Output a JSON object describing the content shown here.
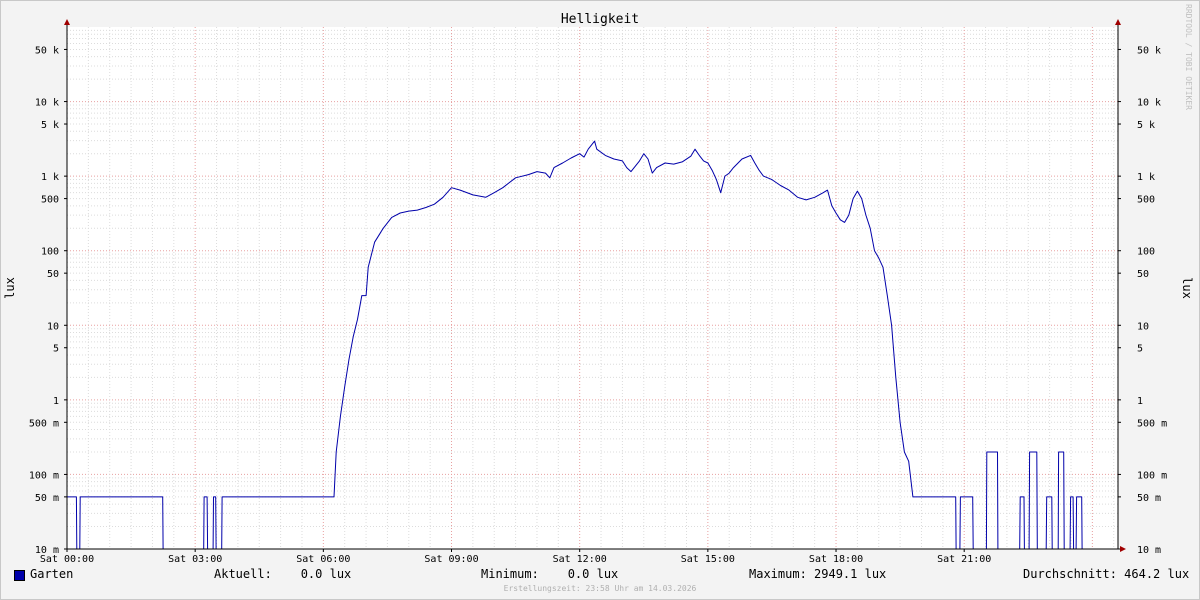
{
  "chart_data": {
    "type": "line",
    "title": "Helligkeit",
    "ylabel": "lux",
    "y_scale": "log",
    "ylim": [
      0.01,
      100000
    ],
    "y_ticks": [
      {
        "value": 50000,
        "label": "50 k"
      },
      {
        "value": 10000,
        "label": "10 k"
      },
      {
        "value": 5000,
        "label": "5 k"
      },
      {
        "value": 1000,
        "label": "1 k"
      },
      {
        "value": 500,
        "label": "500"
      },
      {
        "value": 100,
        "label": "100"
      },
      {
        "value": 50,
        "label": "50"
      },
      {
        "value": 10,
        "label": "10"
      },
      {
        "value": 5,
        "label": "5"
      },
      {
        "value": 1,
        "label": "1"
      },
      {
        "value": 0.5,
        "label": "500 m"
      },
      {
        "value": 0.1,
        "label": "100 m"
      },
      {
        "value": 0.05,
        "label": "50 m"
      },
      {
        "value": 0.01,
        "label": "10 m"
      }
    ],
    "xlim": [
      0,
      24.6
    ],
    "x_ticks": [
      {
        "value": 0,
        "label": "Sat 00:00"
      },
      {
        "value": 3,
        "label": "Sat 03:00"
      },
      {
        "value": 6,
        "label": "Sat 06:00"
      },
      {
        "value": 9,
        "label": "Sat 09:00"
      },
      {
        "value": 12,
        "label": "Sat 12:00"
      },
      {
        "value": 15,
        "label": "Sat 15:00"
      },
      {
        "value": 18,
        "label": "Sat 18:00"
      },
      {
        "value": 21,
        "label": "Sat 21:00"
      }
    ],
    "grid": true,
    "series": [
      {
        "name": "Garten",
        "color": "#0000aa",
        "points": [
          [
            0.0,
            0.05
          ],
          [
            0.22,
            0.05
          ],
          [
            0.23,
            0.01
          ],
          [
            0.3,
            0.01
          ],
          [
            0.31,
            0.05
          ],
          [
            2.24,
            0.05
          ],
          [
            2.25,
            0.01
          ],
          [
            3.2,
            0.01
          ],
          [
            3.21,
            0.05
          ],
          [
            3.28,
            0.05
          ],
          [
            3.29,
            0.01
          ],
          [
            3.42,
            0.01
          ],
          [
            3.43,
            0.05
          ],
          [
            3.48,
            0.05
          ],
          [
            3.49,
            0.01
          ],
          [
            3.62,
            0.01
          ],
          [
            3.63,
            0.05
          ],
          [
            6.25,
            0.05
          ],
          [
            6.3,
            0.2
          ],
          [
            6.4,
            0.6
          ],
          [
            6.5,
            1.5
          ],
          [
            6.6,
            3.5
          ],
          [
            6.7,
            7
          ],
          [
            6.8,
            12
          ],
          [
            6.9,
            25
          ],
          [
            7.0,
            25
          ],
          [
            7.05,
            60
          ],
          [
            7.2,
            130
          ],
          [
            7.4,
            200
          ],
          [
            7.6,
            280
          ],
          [
            7.8,
            320
          ],
          [
            8.0,
            340
          ],
          [
            8.2,
            350
          ],
          [
            8.4,
            380
          ],
          [
            8.6,
            420
          ],
          [
            8.8,
            520
          ],
          [
            9.0,
            700
          ],
          [
            9.2,
            650
          ],
          [
            9.5,
            560
          ],
          [
            9.8,
            520
          ],
          [
            10.0,
            600
          ],
          [
            10.2,
            700
          ],
          [
            10.5,
            950
          ],
          [
            10.8,
            1050
          ],
          [
            11.0,
            1150
          ],
          [
            11.2,
            1100
          ],
          [
            11.3,
            950
          ],
          [
            11.4,
            1300
          ],
          [
            11.6,
            1500
          ],
          [
            11.8,
            1750
          ],
          [
            12.0,
            2000
          ],
          [
            12.1,
            1800
          ],
          [
            12.2,
            2300
          ],
          [
            12.35,
            2950
          ],
          [
            12.4,
            2300
          ],
          [
            12.6,
            1900
          ],
          [
            12.8,
            1700
          ],
          [
            13.0,
            1600
          ],
          [
            13.1,
            1300
          ],
          [
            13.2,
            1150
          ],
          [
            13.4,
            1600
          ],
          [
            13.5,
            2000
          ],
          [
            13.6,
            1700
          ],
          [
            13.7,
            1100
          ],
          [
            13.8,
            1300
          ],
          [
            14.0,
            1500
          ],
          [
            14.2,
            1450
          ],
          [
            14.4,
            1550
          ],
          [
            14.6,
            1850
          ],
          [
            14.7,
            2300
          ],
          [
            14.8,
            1900
          ],
          [
            14.9,
            1600
          ],
          [
            15.0,
            1500
          ],
          [
            15.1,
            1200
          ],
          [
            15.2,
            900
          ],
          [
            15.3,
            600
          ],
          [
            15.4,
            1000
          ],
          [
            15.5,
            1100
          ],
          [
            15.6,
            1300
          ],
          [
            15.8,
            1700
          ],
          [
            16.0,
            1900
          ],
          [
            16.1,
            1500
          ],
          [
            16.2,
            1200
          ],
          [
            16.3,
            1000
          ],
          [
            16.5,
            900
          ],
          [
            16.7,
            750
          ],
          [
            16.9,
            650
          ],
          [
            17.1,
            520
          ],
          [
            17.3,
            480
          ],
          [
            17.5,
            520
          ],
          [
            17.7,
            600
          ],
          [
            17.8,
            650
          ],
          [
            17.9,
            400
          ],
          [
            18.0,
            320
          ],
          [
            18.1,
            260
          ],
          [
            18.2,
            240
          ],
          [
            18.3,
            300
          ],
          [
            18.4,
            500
          ],
          [
            18.5,
            630
          ],
          [
            18.6,
            500
          ],
          [
            18.7,
            300
          ],
          [
            18.8,
            200
          ],
          [
            18.9,
            100
          ],
          [
            19.0,
            80
          ],
          [
            19.1,
            60
          ],
          [
            19.2,
            25
          ],
          [
            19.3,
            10
          ],
          [
            19.4,
            2
          ],
          [
            19.5,
            0.5
          ],
          [
            19.6,
            0.2
          ],
          [
            19.7,
            0.15
          ],
          [
            19.8,
            0.05
          ],
          [
            20.8,
            0.05
          ],
          [
            20.81,
            0.01
          ],
          [
            20.9,
            0.01
          ],
          [
            20.91,
            0.05
          ],
          [
            21.2,
            0.05
          ],
          [
            21.21,
            0.01
          ],
          [
            21.52,
            0.01
          ],
          [
            21.53,
            0.2
          ],
          [
            21.78,
            0.2
          ],
          [
            21.79,
            0.01
          ],
          [
            22.3,
            0.01
          ],
          [
            22.31,
            0.05
          ],
          [
            22.4,
            0.05
          ],
          [
            22.41,
            0.01
          ],
          [
            22.52,
            0.01
          ],
          [
            22.53,
            0.2
          ],
          [
            22.7,
            0.2
          ],
          [
            22.71,
            0.01
          ],
          [
            22.92,
            0.01
          ],
          [
            22.93,
            0.05
          ],
          [
            23.05,
            0.05
          ],
          [
            23.06,
            0.01
          ],
          [
            23.2,
            0.01
          ],
          [
            23.21,
            0.2
          ],
          [
            23.33,
            0.2
          ],
          [
            23.34,
            0.01
          ],
          [
            23.48,
            0.01
          ],
          [
            23.49,
            0.05
          ],
          [
            23.55,
            0.05
          ],
          [
            23.56,
            0.01
          ],
          [
            23.62,
            0.01
          ],
          [
            23.63,
            0.05
          ],
          [
            23.75,
            0.05
          ],
          [
            23.76,
            0.01
          ],
          [
            24.2,
            0.01
          ]
        ]
      }
    ]
  },
  "legend": {
    "series_name": "Garten",
    "current": "Aktuell:    0.0 lux",
    "minimum": "Minimum:    0.0 lux",
    "maximum": "Maximum: 2949.1 lux",
    "average": "Durchschnitt: 464.2 lux"
  },
  "footer": {
    "created": "Erstellungszeit: 23:58 Uhr am 14.03.2026",
    "credit": "RRDTOOL / TOBI OETIKER"
  }
}
